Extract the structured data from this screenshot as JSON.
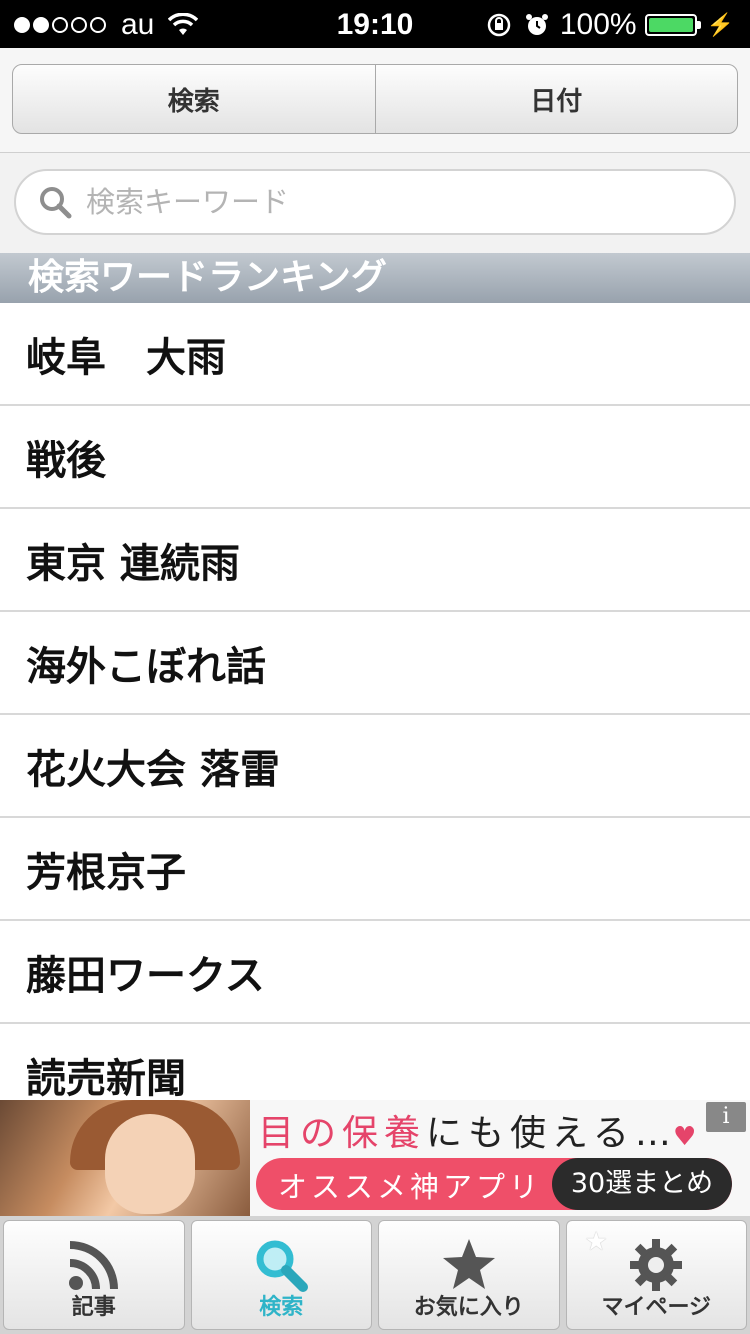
{
  "status_bar": {
    "carrier": "au",
    "time": "19:10",
    "battery": "100%",
    "signal_bars_filled": 2,
    "signal_bars_total": 5
  },
  "segments": {
    "search": "検索",
    "date": "日付"
  },
  "search": {
    "placeholder": "検索キーワード"
  },
  "section_header": "検索ワードランキング",
  "ranking": [
    "岐阜　大雨",
    "戦後",
    "東京 連続雨",
    "海外こぼれ話",
    "花火大会 落雷",
    "芳根京子",
    "藤田ワークス",
    "読売新聞"
  ],
  "ad": {
    "headline_part1": "目の保養",
    "headline_part2": "にも使える…",
    "cta": "オススメ神アプリ",
    "cta_badge": "30選まとめ",
    "info": "i"
  },
  "tabs": [
    {
      "label": "記事",
      "icon": "rss-icon",
      "active": false
    },
    {
      "label": "検索",
      "icon": "search-icon",
      "active": true
    },
    {
      "label": "お気に入り",
      "icon": "star-icon",
      "active": false
    },
    {
      "label": "マイページ",
      "icon": "gear-icon",
      "active": false
    }
  ],
  "colors": {
    "active_tab": "#2fb4c8",
    "ad_pink": "#ef4f69",
    "battery": "#4cd964"
  }
}
